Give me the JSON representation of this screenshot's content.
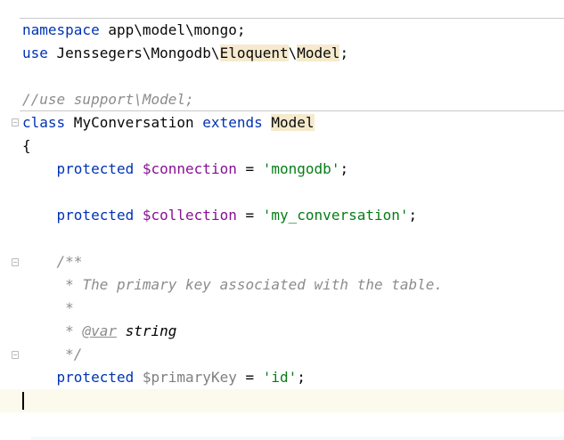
{
  "editor": {
    "lines": [
      {
        "tokens": [
          {
            "t": "namespace",
            "c": "kw"
          },
          {
            "t": " app\\model\\mongo;",
            "c": ""
          }
        ]
      },
      {
        "tokens": [
          {
            "t": "use",
            "c": "kw"
          },
          {
            "t": " Jenssegers\\Mongodb\\",
            "c": ""
          },
          {
            "t": "Eloquent",
            "c": "hl"
          },
          {
            "t": "\\",
            "c": ""
          },
          {
            "t": "Model",
            "c": "hl"
          },
          {
            "t": ";",
            "c": ""
          }
        ]
      },
      {
        "tokens": []
      },
      {
        "tokens": [
          {
            "t": "//use support\\Model;",
            "c": "cmt"
          }
        ]
      },
      {
        "tokens": [
          {
            "t": "class",
            "c": "kw"
          },
          {
            "t": " MyConversation ",
            "c": ""
          },
          {
            "t": "extends",
            "c": "kw"
          },
          {
            "t": " ",
            "c": ""
          },
          {
            "t": "Model",
            "c": "hl"
          }
        ]
      },
      {
        "tokens": [
          {
            "t": "{",
            "c": ""
          }
        ]
      },
      {
        "tokens": [
          {
            "t": "    ",
            "c": ""
          },
          {
            "t": "protected",
            "c": "kw"
          },
          {
            "t": " ",
            "c": ""
          },
          {
            "t": "$connection",
            "c": "var"
          },
          {
            "t": " = ",
            "c": ""
          },
          {
            "t": "'mongodb'",
            "c": "str"
          },
          {
            "t": ";",
            "c": ""
          }
        ]
      },
      {
        "tokens": []
      },
      {
        "tokens": [
          {
            "t": "    ",
            "c": ""
          },
          {
            "t": "protected",
            "c": "kw"
          },
          {
            "t": " ",
            "c": ""
          },
          {
            "t": "$collection",
            "c": "var"
          },
          {
            "t": " = ",
            "c": ""
          },
          {
            "t": "'my_conversation'",
            "c": "str"
          },
          {
            "t": ";",
            "c": ""
          }
        ]
      },
      {
        "tokens": []
      },
      {
        "tokens": [
          {
            "t": "    ",
            "c": ""
          },
          {
            "t": "/**",
            "c": "doc"
          }
        ]
      },
      {
        "tokens": [
          {
            "t": "     ",
            "c": ""
          },
          {
            "t": "* The primary key associated with the table.",
            "c": "doc"
          }
        ]
      },
      {
        "tokens": [
          {
            "t": "     ",
            "c": ""
          },
          {
            "t": "*",
            "c": "doc"
          }
        ]
      },
      {
        "tokens": [
          {
            "t": "     ",
            "c": ""
          },
          {
            "t": "* ",
            "c": "doc"
          },
          {
            "t": "@var",
            "c": "doctag"
          },
          {
            "t": " string",
            "c": "doctype"
          }
        ]
      },
      {
        "tokens": [
          {
            "t": "     ",
            "c": ""
          },
          {
            "t": "*/",
            "c": "doc"
          }
        ]
      },
      {
        "tokens": [
          {
            "t": "    ",
            "c": ""
          },
          {
            "t": "protected",
            "c": "kw"
          },
          {
            "t": " ",
            "c": ""
          },
          {
            "t": "$primaryKey",
            "c": "unused"
          },
          {
            "t": " = ",
            "c": ""
          },
          {
            "t": "'id'",
            "c": "str"
          },
          {
            "t": ";",
            "c": ""
          }
        ]
      },
      {
        "tokens": []
      }
    ]
  }
}
